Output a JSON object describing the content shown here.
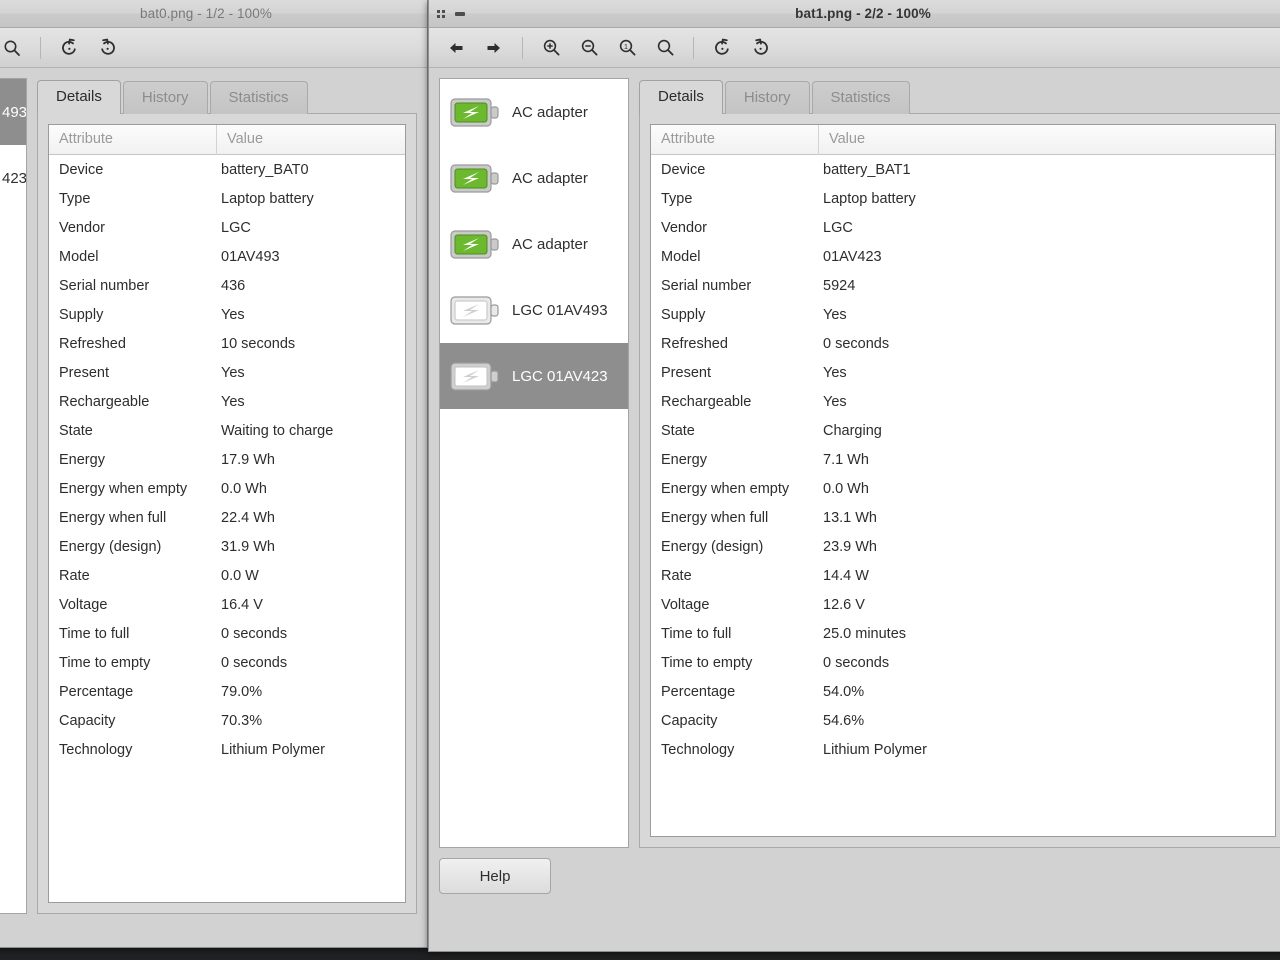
{
  "desktop": {
    "background": "#212224"
  },
  "left_window": {
    "title": "bat0.png - 1/2 - 100%",
    "active": false,
    "toolbar": [
      {
        "name": "search-icon",
        "label": "Search"
      },
      {
        "name": "separator",
        "label": ""
      },
      {
        "name": "rotate-left-icon",
        "label": "Rotate Left"
      },
      {
        "name": "rotate-right-icon",
        "label": "Rotate Right"
      }
    ],
    "device_list": [
      {
        "label": "493",
        "icon": "battery-empty-icon",
        "selected": true
      },
      {
        "label": "423",
        "icon": "battery-empty-icon",
        "selected": false
      }
    ],
    "tabs": [
      {
        "label": "Details",
        "active": true
      },
      {
        "label": "History",
        "active": false
      },
      {
        "label": "Statistics",
        "active": false
      }
    ],
    "table": {
      "headers": [
        "Attribute",
        "Value"
      ],
      "rows": [
        [
          "Device",
          "battery_BAT0"
        ],
        [
          "Type",
          "Laptop battery"
        ],
        [
          "Vendor",
          "LGC"
        ],
        [
          "Model",
          "01AV493"
        ],
        [
          "Serial number",
          "436"
        ],
        [
          "Supply",
          "Yes"
        ],
        [
          "Refreshed",
          "10 seconds"
        ],
        [
          "Present",
          "Yes"
        ],
        [
          "Rechargeable",
          "Yes"
        ],
        [
          "State",
          "Waiting to charge"
        ],
        [
          "Energy",
          "17.9 Wh"
        ],
        [
          "Energy when empty",
          "0.0 Wh"
        ],
        [
          "Energy when full",
          "22.4 Wh"
        ],
        [
          "Energy (design)",
          "31.9 Wh"
        ],
        [
          "Rate",
          "0.0 W"
        ],
        [
          "Voltage",
          "16.4 V"
        ],
        [
          "Time to full",
          "0 seconds"
        ],
        [
          "Time to empty",
          "0 seconds"
        ],
        [
          "Percentage",
          "79.0%"
        ],
        [
          "Capacity",
          "70.3%"
        ],
        [
          "Technology",
          "Lithium Polymer"
        ]
      ]
    }
  },
  "right_window": {
    "title": "bat1.png - 2/2 - 100%",
    "active": true,
    "window_buttons": [
      {
        "name": "window-menu-icon",
        "label": "Window menu"
      },
      {
        "name": "minimize-icon",
        "label": "Minimize"
      }
    ],
    "toolbar": [
      {
        "name": "back-arrow-icon",
        "label": "Previous"
      },
      {
        "name": "forward-arrow-icon",
        "label": "Next"
      },
      {
        "name": "separator",
        "label": ""
      },
      {
        "name": "zoom-in-icon",
        "label": "Zoom In"
      },
      {
        "name": "zoom-out-icon",
        "label": "Zoom Out"
      },
      {
        "name": "zoom-normal-icon",
        "label": "Normal Size"
      },
      {
        "name": "zoom-fit-icon",
        "label": "Best Fit"
      },
      {
        "name": "separator",
        "label": ""
      },
      {
        "name": "rotate-left-icon",
        "label": "Rotate Left"
      },
      {
        "name": "rotate-right-icon",
        "label": "Rotate Right"
      }
    ],
    "device_list": [
      {
        "label": "AC adapter",
        "icon": "battery-charging-green-icon",
        "selected": false
      },
      {
        "label": "AC adapter",
        "icon": "battery-charging-green-icon",
        "selected": false
      },
      {
        "label": "AC adapter",
        "icon": "battery-charging-green-icon",
        "selected": false
      },
      {
        "label": "LGC 01AV493",
        "icon": "battery-empty-icon",
        "selected": false
      },
      {
        "label": "LGC 01AV423",
        "icon": "battery-empty-icon",
        "selected": true
      }
    ],
    "tabs": [
      {
        "label": "Details",
        "active": true
      },
      {
        "label": "History",
        "active": false
      },
      {
        "label": "Statistics",
        "active": false
      }
    ],
    "table": {
      "headers": [
        "Attribute",
        "Value"
      ],
      "rows": [
        [
          "Device",
          "battery_BAT1"
        ],
        [
          "Type",
          "Laptop battery"
        ],
        [
          "Vendor",
          "LGC"
        ],
        [
          "Model",
          "01AV423"
        ],
        [
          "Serial number",
          "5924"
        ],
        [
          "Supply",
          "Yes"
        ],
        [
          "Refreshed",
          "0 seconds"
        ],
        [
          "Present",
          "Yes"
        ],
        [
          "Rechargeable",
          "Yes"
        ],
        [
          "State",
          "Charging"
        ],
        [
          "Energy",
          "7.1 Wh"
        ],
        [
          "Energy when empty",
          "0.0 Wh"
        ],
        [
          "Energy when full",
          "13.1 Wh"
        ],
        [
          "Energy (design)",
          "23.9 Wh"
        ],
        [
          "Rate",
          "14.4 W"
        ],
        [
          "Voltage",
          "12.6 V"
        ],
        [
          "Time to full",
          "25.0 minutes"
        ],
        [
          "Time to empty",
          "0 seconds"
        ],
        [
          "Percentage",
          "54.0%"
        ],
        [
          "Capacity",
          "54.6%"
        ],
        [
          "Technology",
          "Lithium Polymer"
        ]
      ]
    },
    "help_button": "Help"
  },
  "colors": {
    "window_bg": "#d2d2d2",
    "panel_bg": "#d8d8d8",
    "table_bg": "#ffffff",
    "selection": "#8e8e8e",
    "battery_green": "#6cb92f",
    "text": "#2b2d2f",
    "muted_text": "#9a9a9a"
  }
}
